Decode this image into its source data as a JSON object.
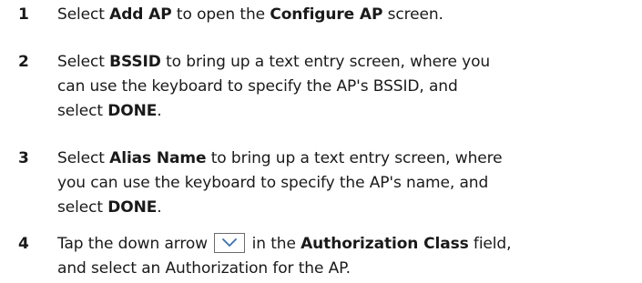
{
  "steps": [
    {
      "number": "1",
      "lines": [
        [
          {
            "t": "Select "
          },
          {
            "t": "Add AP",
            "b": true
          },
          {
            "t": " to open the "
          },
          {
            "t": "Configure AP",
            "b": true
          },
          {
            "t": " screen."
          }
        ]
      ]
    },
    {
      "number": "2",
      "lines": [
        [
          {
            "t": "Select "
          },
          {
            "t": "BSSID",
            "b": true
          },
          {
            "t": " to bring up a text entry screen, where you"
          }
        ],
        [
          {
            "t": "can use the keyboard to specify the AP's BSSID, and"
          }
        ],
        [
          {
            "t": "select "
          },
          {
            "t": "DONE",
            "b": true
          },
          {
            "t": "."
          }
        ]
      ]
    },
    {
      "number": "3",
      "lines": [
        [
          {
            "t": "Select "
          },
          {
            "t": "Alias Name",
            "b": true
          },
          {
            "t": " to bring up a text entry screen, where"
          }
        ],
        [
          {
            "t": "you can use the keyboard to specify the AP's name, and"
          }
        ],
        [
          {
            "t": "select "
          },
          {
            "t": "DONE",
            "b": true
          },
          {
            "t": "."
          }
        ]
      ]
    },
    {
      "number": "4",
      "lines": [
        [
          {
            "t": "Tap the down arrow "
          },
          {
            "icon": "chevron-down-icon"
          },
          {
            "t": " in the "
          },
          {
            "t": "Authorization Class",
            "b": true
          },
          {
            "t": " field,"
          }
        ],
        [
          {
            "t": "and select an Authorization for the AP."
          }
        ]
      ]
    }
  ]
}
